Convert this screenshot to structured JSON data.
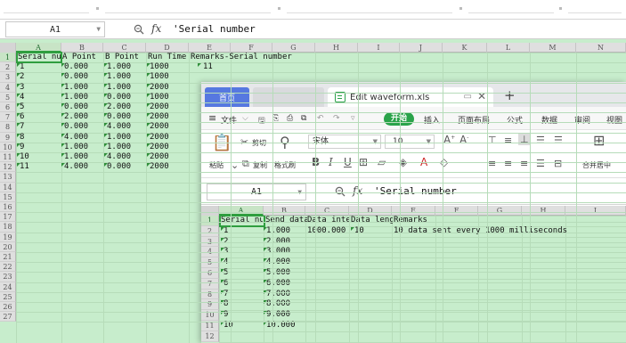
{
  "back": {
    "namebox": "A1",
    "formula": "'Serial number",
    "columns": [
      "A",
      "B",
      "C",
      "D",
      "E",
      "F",
      "G",
      "H",
      "I",
      "J",
      "K",
      "L",
      "M",
      "N"
    ],
    "rows": [
      "1",
      "2",
      "3",
      "4",
      "5",
      "6",
      "7",
      "8",
      "9",
      "10",
      "11",
      "12",
      "13",
      "14",
      "15",
      "16",
      "17",
      "18",
      "19",
      "20",
      "21",
      "22",
      "23",
      "24",
      "25",
      "26",
      "27"
    ],
    "headers": [
      "Serial nu",
      "A Point",
      "B Point",
      "Run Time",
      "Remarks-Serial number"
    ],
    "f1": "11",
    "data": [
      [
        "1",
        "0.000",
        "1.000",
        "1000"
      ],
      [
        "2",
        "0.000",
        "1.000",
        "1000"
      ],
      [
        "3",
        "1.000",
        "1.000",
        "2000"
      ],
      [
        "4",
        "1.000",
        "0.000",
        "1000"
      ],
      [
        "5",
        "0.000",
        "2.000",
        "2000"
      ],
      [
        "6",
        "2.000",
        "0.000",
        "2000"
      ],
      [
        "7",
        "0.000",
        "4.000",
        "2000"
      ],
      [
        "8",
        "4.000",
        "1.000",
        "2000"
      ],
      [
        "9",
        "1.000",
        "1.000",
        "2000"
      ],
      [
        "10",
        "1.000",
        "4.000",
        "2000"
      ],
      [
        "11",
        "4.000",
        "0.000",
        "2000"
      ]
    ]
  },
  "front": {
    "tab_home": "首页",
    "tab_doc": "Edit waveform.xls",
    "menu": [
      "文件",
      "开始",
      "插入",
      "页面布局",
      "公式",
      "数据",
      "审阅",
      "视图"
    ],
    "toolbar": {
      "paste": "粘贴",
      "cut": "剪切",
      "copy": "复制",
      "format_painter": "格式刷",
      "font": "宋体",
      "font_size": "10",
      "merge": "合并居中"
    },
    "namebox": "A1",
    "formula": "'Serial number",
    "columns": [
      "A",
      "B",
      "C",
      "D",
      "E",
      "F",
      "G",
      "H",
      "I"
    ],
    "rows": [
      "1",
      "2",
      "3",
      "4",
      "5",
      "6",
      "7",
      "8",
      "9",
      "10",
      "11",
      "12"
    ],
    "headers": [
      "Serial nu",
      "Send data",
      "Data inte",
      "Data leng",
      "Remarks"
    ],
    "row2": {
      "c": "1000.000",
      "d": "10",
      "e": "10 data sent every 1000 milliseconds"
    },
    "data": [
      [
        "1",
        "1.000"
      ],
      [
        "2",
        "2.000"
      ],
      [
        "3",
        "3.000"
      ],
      [
        "4",
        "4.000"
      ],
      [
        "5",
        "5.000"
      ],
      [
        "6",
        "6.000"
      ],
      [
        "7",
        "7.000"
      ],
      [
        "8",
        "8.000"
      ],
      [
        "9",
        "9.000"
      ],
      [
        "10",
        "10.000"
      ]
    ]
  }
}
